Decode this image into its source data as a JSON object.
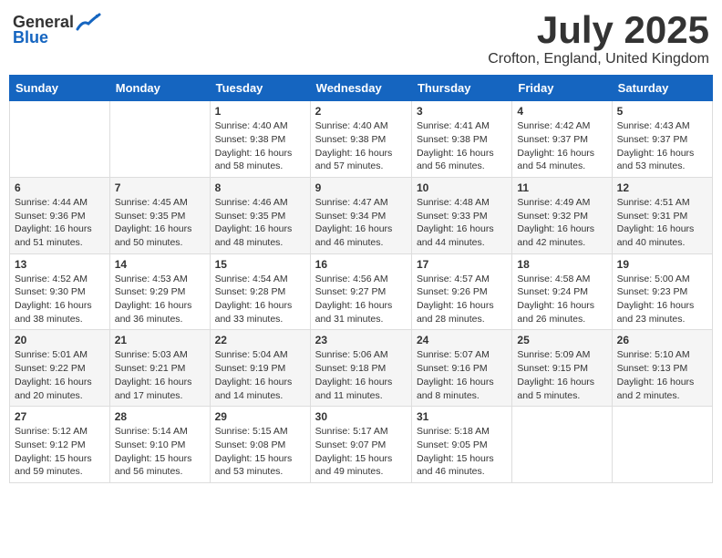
{
  "header": {
    "logo_general": "General",
    "logo_blue": "Blue",
    "month_title": "July 2025",
    "location": "Crofton, England, United Kingdom"
  },
  "days_of_week": [
    "Sunday",
    "Monday",
    "Tuesday",
    "Wednesday",
    "Thursday",
    "Friday",
    "Saturday"
  ],
  "weeks": [
    [
      {
        "day": "",
        "sunrise": "",
        "sunset": "",
        "daylight": ""
      },
      {
        "day": "",
        "sunrise": "",
        "sunset": "",
        "daylight": ""
      },
      {
        "day": "1",
        "sunrise": "Sunrise: 4:40 AM",
        "sunset": "Sunset: 9:38 PM",
        "daylight": "Daylight: 16 hours and 58 minutes."
      },
      {
        "day": "2",
        "sunrise": "Sunrise: 4:40 AM",
        "sunset": "Sunset: 9:38 PM",
        "daylight": "Daylight: 16 hours and 57 minutes."
      },
      {
        "day": "3",
        "sunrise": "Sunrise: 4:41 AM",
        "sunset": "Sunset: 9:38 PM",
        "daylight": "Daylight: 16 hours and 56 minutes."
      },
      {
        "day": "4",
        "sunrise": "Sunrise: 4:42 AM",
        "sunset": "Sunset: 9:37 PM",
        "daylight": "Daylight: 16 hours and 54 minutes."
      },
      {
        "day": "5",
        "sunrise": "Sunrise: 4:43 AM",
        "sunset": "Sunset: 9:37 PM",
        "daylight": "Daylight: 16 hours and 53 minutes."
      }
    ],
    [
      {
        "day": "6",
        "sunrise": "Sunrise: 4:44 AM",
        "sunset": "Sunset: 9:36 PM",
        "daylight": "Daylight: 16 hours and 51 minutes."
      },
      {
        "day": "7",
        "sunrise": "Sunrise: 4:45 AM",
        "sunset": "Sunset: 9:35 PM",
        "daylight": "Daylight: 16 hours and 50 minutes."
      },
      {
        "day": "8",
        "sunrise": "Sunrise: 4:46 AM",
        "sunset": "Sunset: 9:35 PM",
        "daylight": "Daylight: 16 hours and 48 minutes."
      },
      {
        "day": "9",
        "sunrise": "Sunrise: 4:47 AM",
        "sunset": "Sunset: 9:34 PM",
        "daylight": "Daylight: 16 hours and 46 minutes."
      },
      {
        "day": "10",
        "sunrise": "Sunrise: 4:48 AM",
        "sunset": "Sunset: 9:33 PM",
        "daylight": "Daylight: 16 hours and 44 minutes."
      },
      {
        "day": "11",
        "sunrise": "Sunrise: 4:49 AM",
        "sunset": "Sunset: 9:32 PM",
        "daylight": "Daylight: 16 hours and 42 minutes."
      },
      {
        "day": "12",
        "sunrise": "Sunrise: 4:51 AM",
        "sunset": "Sunset: 9:31 PM",
        "daylight": "Daylight: 16 hours and 40 minutes."
      }
    ],
    [
      {
        "day": "13",
        "sunrise": "Sunrise: 4:52 AM",
        "sunset": "Sunset: 9:30 PM",
        "daylight": "Daylight: 16 hours and 38 minutes."
      },
      {
        "day": "14",
        "sunrise": "Sunrise: 4:53 AM",
        "sunset": "Sunset: 9:29 PM",
        "daylight": "Daylight: 16 hours and 36 minutes."
      },
      {
        "day": "15",
        "sunrise": "Sunrise: 4:54 AM",
        "sunset": "Sunset: 9:28 PM",
        "daylight": "Daylight: 16 hours and 33 minutes."
      },
      {
        "day": "16",
        "sunrise": "Sunrise: 4:56 AM",
        "sunset": "Sunset: 9:27 PM",
        "daylight": "Daylight: 16 hours and 31 minutes."
      },
      {
        "day": "17",
        "sunrise": "Sunrise: 4:57 AM",
        "sunset": "Sunset: 9:26 PM",
        "daylight": "Daylight: 16 hours and 28 minutes."
      },
      {
        "day": "18",
        "sunrise": "Sunrise: 4:58 AM",
        "sunset": "Sunset: 9:24 PM",
        "daylight": "Daylight: 16 hours and 26 minutes."
      },
      {
        "day": "19",
        "sunrise": "Sunrise: 5:00 AM",
        "sunset": "Sunset: 9:23 PM",
        "daylight": "Daylight: 16 hours and 23 minutes."
      }
    ],
    [
      {
        "day": "20",
        "sunrise": "Sunrise: 5:01 AM",
        "sunset": "Sunset: 9:22 PM",
        "daylight": "Daylight: 16 hours and 20 minutes."
      },
      {
        "day": "21",
        "sunrise": "Sunrise: 5:03 AM",
        "sunset": "Sunset: 9:21 PM",
        "daylight": "Daylight: 16 hours and 17 minutes."
      },
      {
        "day": "22",
        "sunrise": "Sunrise: 5:04 AM",
        "sunset": "Sunset: 9:19 PM",
        "daylight": "Daylight: 16 hours and 14 minutes."
      },
      {
        "day": "23",
        "sunrise": "Sunrise: 5:06 AM",
        "sunset": "Sunset: 9:18 PM",
        "daylight": "Daylight: 16 hours and 11 minutes."
      },
      {
        "day": "24",
        "sunrise": "Sunrise: 5:07 AM",
        "sunset": "Sunset: 9:16 PM",
        "daylight": "Daylight: 16 hours and 8 minutes."
      },
      {
        "day": "25",
        "sunrise": "Sunrise: 5:09 AM",
        "sunset": "Sunset: 9:15 PM",
        "daylight": "Daylight: 16 hours and 5 minutes."
      },
      {
        "day": "26",
        "sunrise": "Sunrise: 5:10 AM",
        "sunset": "Sunset: 9:13 PM",
        "daylight": "Daylight: 16 hours and 2 minutes."
      }
    ],
    [
      {
        "day": "27",
        "sunrise": "Sunrise: 5:12 AM",
        "sunset": "Sunset: 9:12 PM",
        "daylight": "Daylight: 15 hours and 59 minutes."
      },
      {
        "day": "28",
        "sunrise": "Sunrise: 5:14 AM",
        "sunset": "Sunset: 9:10 PM",
        "daylight": "Daylight: 15 hours and 56 minutes."
      },
      {
        "day": "29",
        "sunrise": "Sunrise: 5:15 AM",
        "sunset": "Sunset: 9:08 PM",
        "daylight": "Daylight: 15 hours and 53 minutes."
      },
      {
        "day": "30",
        "sunrise": "Sunrise: 5:17 AM",
        "sunset": "Sunset: 9:07 PM",
        "daylight": "Daylight: 15 hours and 49 minutes."
      },
      {
        "day": "31",
        "sunrise": "Sunrise: 5:18 AM",
        "sunset": "Sunset: 9:05 PM",
        "daylight": "Daylight: 15 hours and 46 minutes."
      },
      {
        "day": "",
        "sunrise": "",
        "sunset": "",
        "daylight": ""
      },
      {
        "day": "",
        "sunrise": "",
        "sunset": "",
        "daylight": ""
      }
    ]
  ]
}
